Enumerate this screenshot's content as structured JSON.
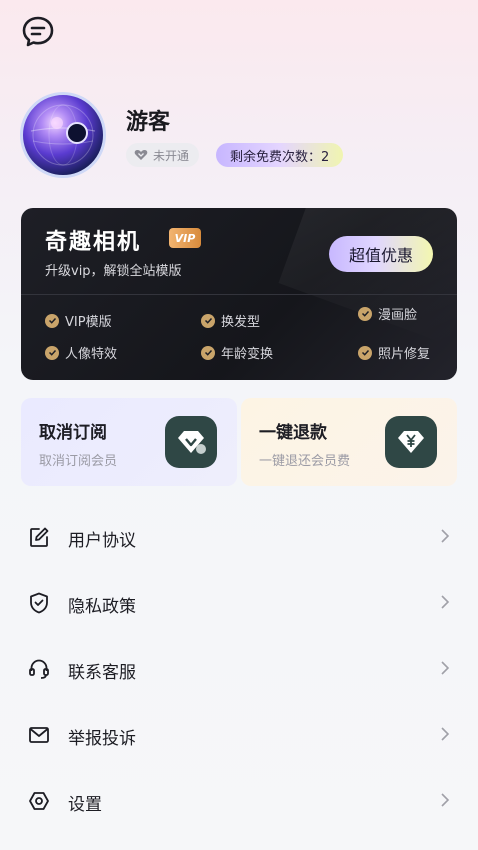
{
  "header": {
    "message_icon": "chat-bubble-icon"
  },
  "profile": {
    "name": "游客",
    "status_icon": "heart-icon",
    "status_label": "未开通",
    "free_uses_label": "剩余免费次数：2"
  },
  "vip": {
    "title": "奇趣相机",
    "badge": "VIP",
    "subtitle": "升级vip，解锁全站模版",
    "deal_button": "超值优惠",
    "features": [
      "VIP模版",
      "换发型",
      "漫画脸",
      "人像特效",
      "年龄变换",
      "照片修复"
    ],
    "accent": "#c9a46a"
  },
  "actions": [
    {
      "title": "取消订阅",
      "subtitle": "取消订阅会员",
      "icon": "vip-diamond-icon"
    },
    {
      "title": "一键退款",
      "subtitle": "一键退还会员费",
      "icon": "yen-diamond-icon"
    }
  ],
  "menu": [
    {
      "label": "用户协议",
      "icon": "edit-icon"
    },
    {
      "label": "隐私政策",
      "icon": "shield-icon"
    },
    {
      "label": "联系客服",
      "icon": "headset-icon"
    },
    {
      "label": "举报投诉",
      "icon": "mail-icon"
    },
    {
      "label": "设置",
      "icon": "settings-icon"
    }
  ]
}
